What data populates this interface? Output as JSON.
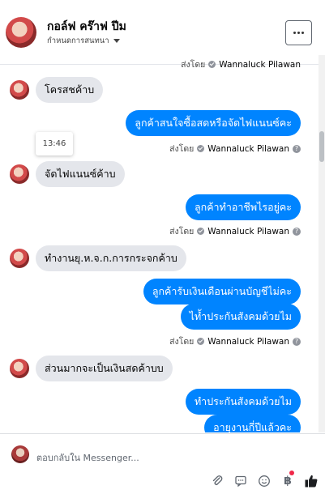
{
  "header": {
    "name": "กอล์ฟ คร๊าฟ ปีม",
    "subtitle": "กำหนดการสนทนา"
  },
  "thread": {
    "top_partial_sender": "ส่งโดย",
    "top_partial_name": "Wannaluck Pilawan",
    "timestamp_tooltip": "13:46",
    "messages": [
      {
        "side": "in",
        "text": "โครสชค้าบ"
      },
      {
        "side": "out",
        "text": "ลูกค้าสนใจซื้อสดหรือจัดไฟแนนซ์คะ",
        "sent_by": "ส่งโดย",
        "sender": "Wannaluck Pilawan"
      },
      {
        "side": "in",
        "text": "จัดไฟแนนซ์ค้าบ"
      },
      {
        "side": "out",
        "text": "ลูกค้าทำอาชีพไรอยู่คะ",
        "sent_by": "ส่งโดย",
        "sender": "Wannaluck Pilawan"
      },
      {
        "side": "in",
        "text": "ทำงานยุ.ห.จ.ก.การกระจกค้าบ"
      },
      {
        "side": "out",
        "text": "ลูกค้ารับเงินเดือนผ่านบัญชีไม่คะ"
      },
      {
        "side": "out",
        "text": "ไท้ำประกันสังคมด้วยไม",
        "sent_by": "ส่งโดย",
        "sender": "Wannaluck Pilawan"
      },
      {
        "side": "in",
        "text": "ส่วนมากจะเป็นเงินสดค้าบบ"
      },
      {
        "side": "out",
        "text": "ทำประกันสังคมด้วยไม"
      },
      {
        "side": "out",
        "text": "อายุงานกี่ปีแล้วคะ"
      }
    ]
  },
  "composer": {
    "placeholder": "ตอบกลับใน Messenger..."
  },
  "colors": {
    "outgoing_bubble": "#0084ff",
    "incoming_bubble": "#e4e6eb",
    "notification_dot": "#f02849"
  },
  "icons": [
    "more-options-icon",
    "caret-down-icon",
    "sent-check-icon",
    "help-icon",
    "attachment-icon",
    "sticker-icon",
    "emoji-icon",
    "baht-icon",
    "like-icon"
  ]
}
